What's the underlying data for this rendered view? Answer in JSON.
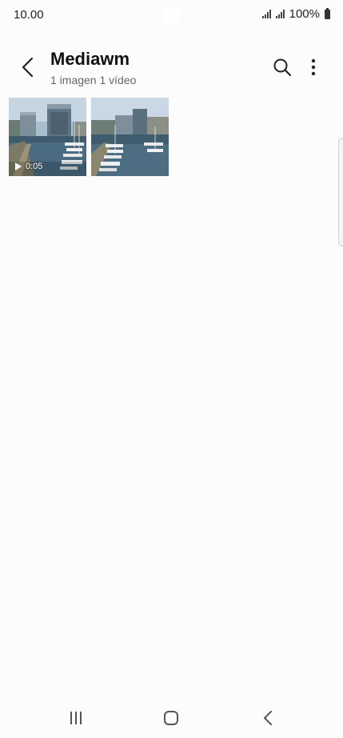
{
  "status": {
    "time": "10.00",
    "battery": "100%"
  },
  "header": {
    "title": "Mediawm",
    "subtitle": "1 imagen 1 vídeo",
    "icons": {
      "back": "back-arrow-icon",
      "search": "search-icon",
      "more": "more-options-icon"
    }
  },
  "grid": {
    "items": [
      {
        "type": "video",
        "duration": "0:05"
      },
      {
        "type": "image"
      }
    ]
  },
  "nav": {
    "icons": [
      "recents-icon",
      "home-icon",
      "back-icon"
    ]
  },
  "colors": {
    "background": "#fcfcfc",
    "text": "#111111",
    "subtitle": "#666666"
  }
}
